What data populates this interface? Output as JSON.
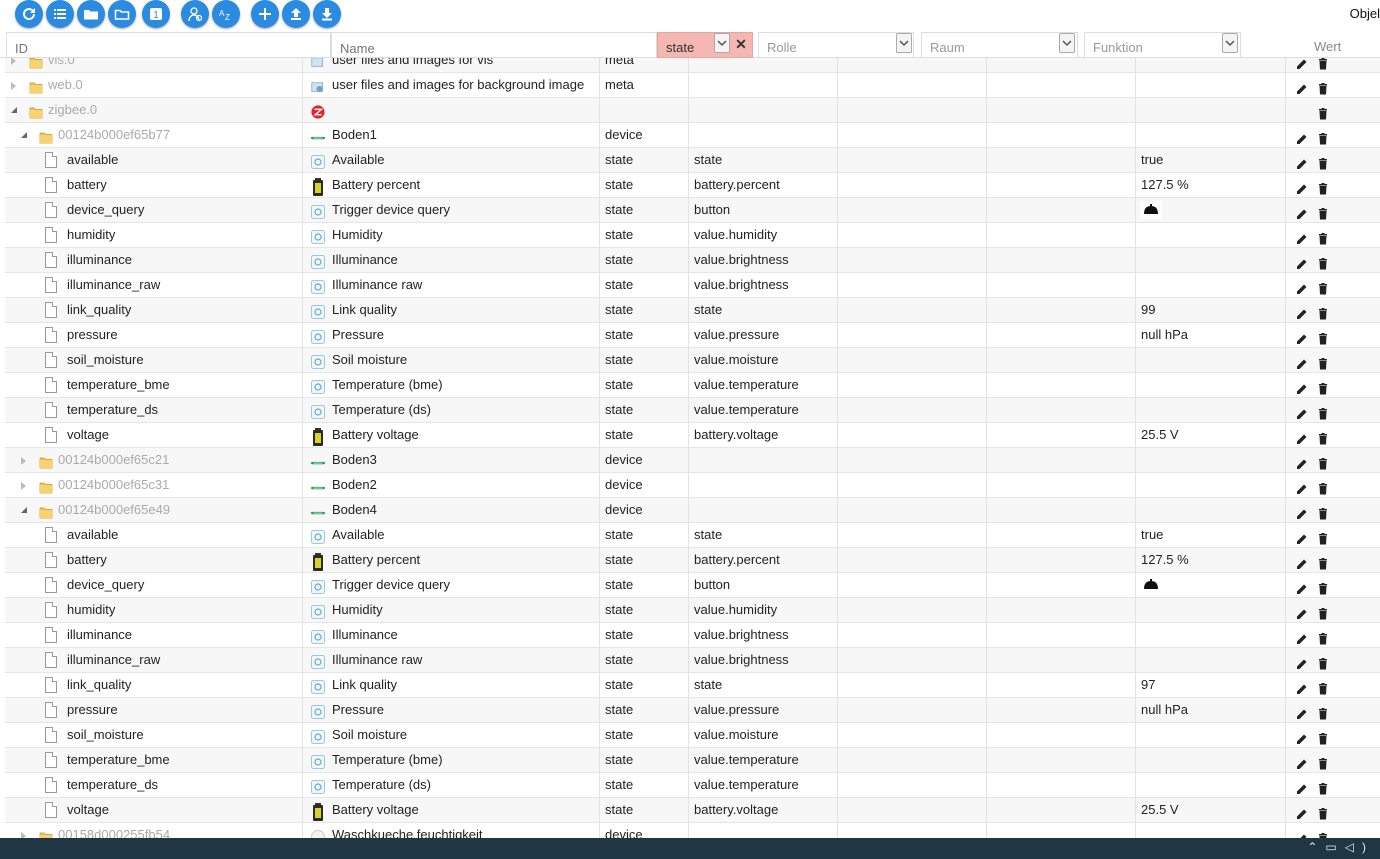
{
  "toolbar": {
    "buttons": [
      {
        "icon": "refresh-icon"
      },
      {
        "icon": "list-icon"
      },
      {
        "icon": "folder-icon"
      },
      {
        "icon": "folder-outline-icon"
      },
      {
        "icon": "one-icon",
        "label": "1"
      },
      {
        "icon": "admin-user-icon"
      },
      {
        "icon": "sort-az-icon",
        "label": "AZ"
      },
      {
        "icon": "plus-icon"
      },
      {
        "icon": "upload-icon"
      },
      {
        "icon": "download-icon"
      }
    ],
    "right_text": "Objel"
  },
  "filters": {
    "id_placeholder": "ID",
    "name_placeholder": "Name",
    "type_value": "state",
    "role_placeholder": "Rolle",
    "room_placeholder": "Raum",
    "function_placeholder": "Funktion",
    "value_header": "Wert"
  },
  "colors": {
    "accent": "#2b8be0",
    "filter_active": "#f5b7b1",
    "taskbar": "#1f3745"
  },
  "rows": [
    {
      "id": "vis.0",
      "kind": "folder",
      "level": 0,
      "expanded": false,
      "gray": true,
      "name": "user files and images for vis",
      "icon": "vis-icon",
      "type": "meta",
      "role": "",
      "value": "",
      "partial": true
    },
    {
      "id": "web.0",
      "kind": "folder",
      "level": 0,
      "expanded": false,
      "gray": true,
      "name": "user files and images for background image",
      "icon": "web-icon",
      "type": "meta",
      "role": "",
      "value": ""
    },
    {
      "id": "zigbee.0",
      "kind": "folder",
      "level": 0,
      "expanded": true,
      "gray": true,
      "name": "",
      "icon": "zigbee-icon",
      "type": "",
      "role": "",
      "value": "",
      "noedit": true
    },
    {
      "id": "00124b000ef65b77",
      "kind": "folder",
      "level": 1,
      "expanded": true,
      "gray": true,
      "name": "Boden1",
      "icon": "device-icon",
      "type": "device",
      "role": "",
      "value": ""
    },
    {
      "id": "available",
      "kind": "file",
      "level": 2,
      "name": "Available",
      "icon": "state-icon",
      "type": "state",
      "role": "state",
      "value": "true"
    },
    {
      "id": "battery",
      "kind": "file",
      "level": 2,
      "name": "Battery percent",
      "icon": "battery-icon",
      "type": "state",
      "role": "battery.percent",
      "value": "127.5 %"
    },
    {
      "id": "device_query",
      "kind": "file",
      "level": 2,
      "name": "Trigger device query",
      "icon": "state-icon",
      "type": "state",
      "role": "button",
      "value": "",
      "bell": true
    },
    {
      "id": "humidity",
      "kind": "file",
      "level": 2,
      "name": "Humidity",
      "icon": "state-icon",
      "type": "state",
      "role": "value.humidity",
      "value": ""
    },
    {
      "id": "illuminance",
      "kind": "file",
      "level": 2,
      "name": "Illuminance",
      "icon": "state-icon",
      "type": "state",
      "role": "value.brightness",
      "value": ""
    },
    {
      "id": "illuminance_raw",
      "kind": "file",
      "level": 2,
      "name": "Illuminance raw",
      "icon": "state-icon",
      "type": "state",
      "role": "value.brightness",
      "value": ""
    },
    {
      "id": "link_quality",
      "kind": "file",
      "level": 2,
      "name": "Link quality",
      "icon": "state-icon",
      "type": "state",
      "role": "state",
      "value": "99"
    },
    {
      "id": "pressure",
      "kind": "file",
      "level": 2,
      "name": "Pressure",
      "icon": "state-icon",
      "type": "state",
      "role": "value.pressure",
      "value": "null hPa"
    },
    {
      "id": "soil_moisture",
      "kind": "file",
      "level": 2,
      "name": "Soil moisture",
      "icon": "state-icon",
      "type": "state",
      "role": "value.moisture",
      "value": ""
    },
    {
      "id": "temperature_bme",
      "kind": "file",
      "level": 2,
      "name": "Temperature (bme)",
      "icon": "state-icon",
      "type": "state",
      "role": "value.temperature",
      "value": ""
    },
    {
      "id": "temperature_ds",
      "kind": "file",
      "level": 2,
      "name": "Temperature (ds)",
      "icon": "state-icon",
      "type": "state",
      "role": "value.temperature",
      "value": ""
    },
    {
      "id": "voltage",
      "kind": "file",
      "level": 2,
      "name": "Battery voltage",
      "icon": "battery-icon",
      "type": "state",
      "role": "battery.voltage",
      "value": "25.5 V"
    },
    {
      "id": "00124b000ef65c21",
      "kind": "folder",
      "level": 1,
      "expanded": false,
      "gray": true,
      "name": "Boden3",
      "icon": "device-icon",
      "type": "device",
      "role": "",
      "value": ""
    },
    {
      "id": "00124b000ef65c31",
      "kind": "folder",
      "level": 1,
      "expanded": false,
      "gray": true,
      "name": "Boden2",
      "icon": "device-icon",
      "type": "device",
      "role": "",
      "value": ""
    },
    {
      "id": "00124b000ef65e49",
      "kind": "folder",
      "level": 1,
      "expanded": true,
      "gray": true,
      "name": "Boden4",
      "icon": "device-icon",
      "type": "device",
      "role": "",
      "value": ""
    },
    {
      "id": "available",
      "kind": "file",
      "level": 2,
      "name": "Available",
      "icon": "state-icon",
      "type": "state",
      "role": "state",
      "value": "true"
    },
    {
      "id": "battery",
      "kind": "file",
      "level": 2,
      "name": "Battery percent",
      "icon": "battery-icon",
      "type": "state",
      "role": "battery.percent",
      "value": "127.5 %"
    },
    {
      "id": "device_query",
      "kind": "file",
      "level": 2,
      "name": "Trigger device query",
      "icon": "state-icon",
      "type": "state",
      "role": "button",
      "value": "",
      "bell": true
    },
    {
      "id": "humidity",
      "kind": "file",
      "level": 2,
      "name": "Humidity",
      "icon": "state-icon",
      "type": "state",
      "role": "value.humidity",
      "value": ""
    },
    {
      "id": "illuminance",
      "kind": "file",
      "level": 2,
      "name": "Illuminance",
      "icon": "state-icon",
      "type": "state",
      "role": "value.brightness",
      "value": ""
    },
    {
      "id": "illuminance_raw",
      "kind": "file",
      "level": 2,
      "name": "Illuminance raw",
      "icon": "state-icon",
      "type": "state",
      "role": "value.brightness",
      "value": ""
    },
    {
      "id": "link_quality",
      "kind": "file",
      "level": 2,
      "name": "Link quality",
      "icon": "state-icon",
      "type": "state",
      "role": "state",
      "value": "97"
    },
    {
      "id": "pressure",
      "kind": "file",
      "level": 2,
      "name": "Pressure",
      "icon": "state-icon",
      "type": "state",
      "role": "value.pressure",
      "value": "null hPa"
    },
    {
      "id": "soil_moisture",
      "kind": "file",
      "level": 2,
      "name": "Soil moisture",
      "icon": "state-icon",
      "type": "state",
      "role": "value.moisture",
      "value": ""
    },
    {
      "id": "temperature_bme",
      "kind": "file",
      "level": 2,
      "name": "Temperature (bme)",
      "icon": "state-icon",
      "type": "state",
      "role": "value.temperature",
      "value": ""
    },
    {
      "id": "temperature_ds",
      "kind": "file",
      "level": 2,
      "name": "Temperature (ds)",
      "icon": "state-icon",
      "type": "state",
      "role": "value.temperature",
      "value": ""
    },
    {
      "id": "voltage",
      "kind": "file",
      "level": 2,
      "name": "Battery voltage",
      "icon": "battery-icon",
      "type": "state",
      "role": "battery.voltage",
      "value": "25.5 V"
    },
    {
      "id": "00158d000255fb54",
      "kind": "folder",
      "level": 1,
      "expanded": false,
      "gray": true,
      "name": "Waschkueche feuchtigkeit",
      "icon": "sensor-icon",
      "type": "device",
      "role": "",
      "value": ""
    }
  ]
}
